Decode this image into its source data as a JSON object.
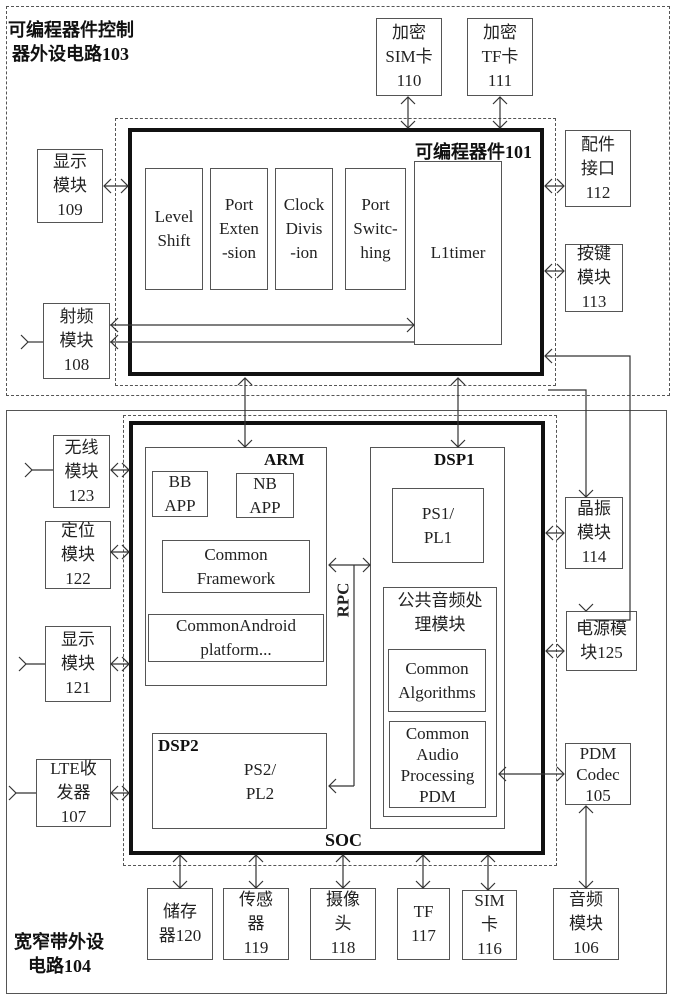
{
  "regions": {
    "pld_peripheral": {
      "line1": "可编程器件控制",
      "line2": "器外设电路103"
    },
    "broadband_peripheral": {
      "line1": "宽窄带外设",
      "line2": "电路104"
    }
  },
  "pld": {
    "title": "可编程器件101",
    "blocks": [
      {
        "lines": [
          "Level",
          "Shift"
        ]
      },
      {
        "lines": [
          "Port",
          "Exten",
          "-sion"
        ]
      },
      {
        "lines": [
          "Clock",
          "Divis",
          "-ion"
        ]
      },
      {
        "lines": [
          "Port",
          "Switc-",
          "hing"
        ]
      },
      {
        "lines": [
          "L1timer"
        ]
      }
    ]
  },
  "top_peripherals": [
    {
      "lines": [
        "加密",
        "SIM卡",
        "110"
      ]
    },
    {
      "lines": [
        "加密",
        "TF卡",
        "111"
      ]
    }
  ],
  "pld_left_peripherals": [
    {
      "lines": [
        "显示",
        "模块",
        "109"
      ]
    },
    {
      "lines": [
        "射频",
        "模块",
        "108"
      ]
    }
  ],
  "pld_right_peripherals": [
    {
      "lines": [
        "配件",
        "接口",
        "112"
      ]
    },
    {
      "lines": [
        "按键",
        "模块",
        "113"
      ]
    }
  ],
  "soc": {
    "title": "SOC",
    "arm": {
      "title": "ARM",
      "bb_app": {
        "lines": [
          "BB",
          "APP"
        ]
      },
      "nb_app": {
        "lines": [
          "NB",
          "APP"
        ]
      },
      "framework": {
        "lines": [
          "Common",
          "Framework"
        ]
      },
      "android": {
        "lines": [
          "CommonAndroid",
          "platform..."
        ]
      }
    },
    "rpc_label": "RPC",
    "dsp1": {
      "title": "DSP1",
      "ps1": {
        "lines": [
          "PS1/",
          "PL1"
        ]
      },
      "audio_module": {
        "lines": [
          "公共音频处",
          "理模块"
        ]
      },
      "algorithms": {
        "lines": [
          "Common",
          "Algorithms"
        ]
      },
      "audio_pdm": {
        "lines": [
          "Common",
          "Audio",
          "Processing",
          "PDM"
        ]
      }
    },
    "dsp2": {
      "title": "DSP2",
      "lines": [
        "PS2/",
        "PL2"
      ]
    }
  },
  "soc_left_peripherals": [
    {
      "lines": [
        "无线",
        "模块",
        "123"
      ]
    },
    {
      "lines": [
        "定位",
        "模块",
        "122"
      ]
    },
    {
      "lines": [
        "显示",
        "模块",
        "121"
      ]
    },
    {
      "lines": [
        "LTE收",
        "发器",
        "107"
      ]
    }
  ],
  "soc_right_peripherals": [
    {
      "lines": [
        "晶振",
        "模块",
        "114"
      ]
    },
    {
      "lines": [
        "电源模",
        "块125"
      ]
    },
    {
      "lines": [
        "PDM",
        "Codec",
        "105"
      ]
    }
  ],
  "bottom_peripherals": [
    {
      "lines": [
        "储存",
        "器120"
      ]
    },
    {
      "lines": [
        "传感",
        "器",
        "119"
      ]
    },
    {
      "lines": [
        "摄像",
        "头",
        "118"
      ]
    },
    {
      "lines": [
        "TF",
        "117"
      ]
    },
    {
      "lines": [
        "SIM",
        "卡",
        "116"
      ]
    },
    {
      "lines": [
        "音频",
        "模块",
        "106"
      ]
    }
  ]
}
